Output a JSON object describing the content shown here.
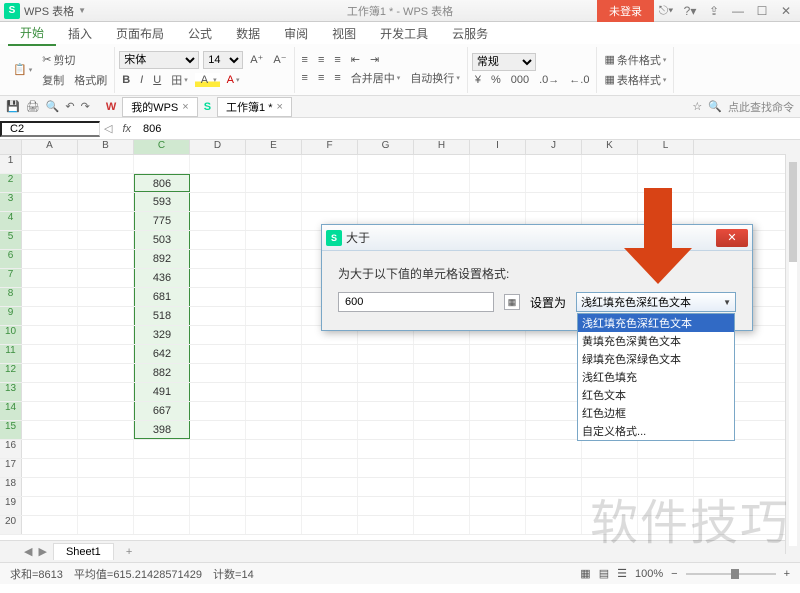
{
  "titlebar": {
    "appName": "WPS 表格",
    "docTitle": "工作簿1 * - WPS 表格",
    "login": "未登录"
  },
  "tabs": {
    "t0": "开始",
    "t1": "插入",
    "t2": "页面布局",
    "t3": "公式",
    "t4": "数据",
    "t5": "审阅",
    "t6": "视图",
    "t7": "开发工具",
    "t8": "云服务"
  },
  "ribbon": {
    "cut": "剪切",
    "copy": "复制",
    "fmtPaint": "格式刷",
    "paste": "粘贴",
    "font": "宋体",
    "size": "14",
    "merge": "合并居中",
    "wrap": "自动换行",
    "numfmt": "常规",
    "condfmt": "条件格式",
    "cellstyle": "表格样式"
  },
  "qat": {
    "wpsTab": "我的WPS",
    "docTab": "工作簿1 *",
    "searchHint": "点此查找命令"
  },
  "cellref": {
    "name": "C2",
    "val": "806"
  },
  "cols": [
    "A",
    "B",
    "C",
    "D",
    "E",
    "F",
    "G",
    "H",
    "I",
    "J",
    "K",
    "L"
  ],
  "c_data": [
    "",
    "806",
    "593",
    "775",
    "503",
    "892",
    "436",
    "681",
    "518",
    "329",
    "642",
    "882",
    "491",
    "667",
    "398",
    "",
    "",
    "",
    "",
    ""
  ],
  "dialog": {
    "title": "大于",
    "label": "为大于以下值的单元格设置格式:",
    "value": "600",
    "setAs": "设置为",
    "selected": "浅红填充色深红色文本",
    "opts": [
      "浅红填充色深红色文本",
      "黄填充色深黄色文本",
      "绿填充色深绿色文本",
      "浅红色填充",
      "红色文本",
      "红色边框",
      "自定义格式..."
    ]
  },
  "sheetTabs": {
    "s1": "Sheet1"
  },
  "statusbar": {
    "stats": "求和=8613　平均值=615.21428571429　计数=14",
    "zoom": "100%"
  },
  "watermark": "软件技巧"
}
